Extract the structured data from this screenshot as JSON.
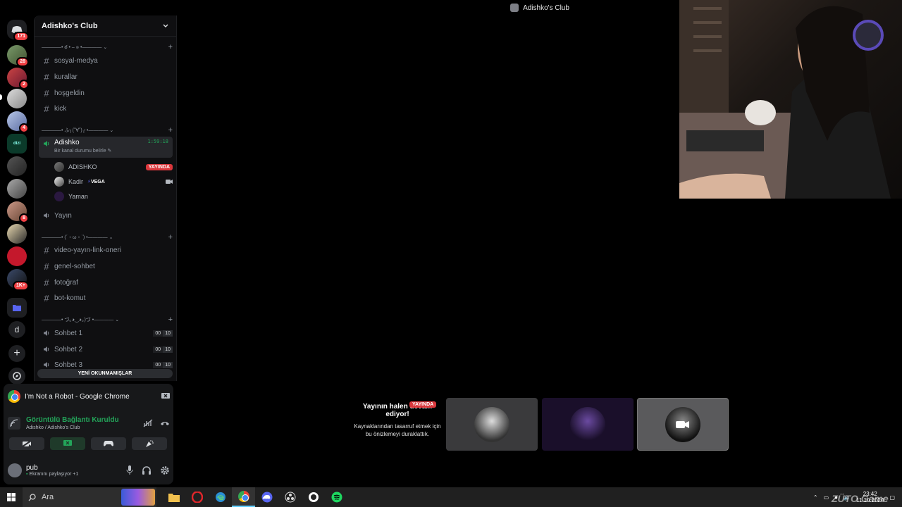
{
  "window": {
    "title": "Adishko's Club"
  },
  "rail": {
    "badges": [
      "171",
      "28",
      "2",
      "",
      "4",
      "",
      "",
      "",
      "8",
      "",
      "",
      "1K+"
    ],
    "dm_letter": "d"
  },
  "server": {
    "name": "Adishko's Club",
    "categories": [
      "————• ఠ • – ๏ •————",
      "————• ふ╮(˘∀˘)╭ •————",
      "————• (´・ω・`) •————",
      "————• づ｡◕‿◕｡)づ •————"
    ],
    "text_channels_1": [
      "sosyal-medya",
      "kurallar",
      "hoşgeldin",
      "kick"
    ],
    "active_voice": {
      "name": "Adishko",
      "timer": "1:59:18",
      "status": "Bir kanal durumu belirle"
    },
    "members": [
      {
        "name": "ADISHKO",
        "badge": "YAYINDA"
      },
      {
        "name": "Kadir",
        "tag": "VEGA"
      },
      {
        "name": "Yaman"
      }
    ],
    "voice_2": "Yayın",
    "text_channels_2": [
      "video-yayın-link-oneri",
      "genel-sohbet",
      "fotoğraf",
      "bot-komut"
    ],
    "voice_channels": [
      {
        "name": "Sohbet 1",
        "a": "00",
        "b": "10"
      },
      {
        "name": "Sohbet 2",
        "a": "00",
        "b": "10"
      },
      {
        "name": "Sohbet 3",
        "a": "00",
        "b": "10"
      }
    ],
    "unread_label": "YENİ OKUNMAMIŞLAR"
  },
  "panel": {
    "stream_title": "I'm Not a Robot - Google Chrome",
    "connection_status": "Görüntülü Bağlantı Kuruldu",
    "connection_sub": "Adishko / Adishko's Club",
    "user_name": "pub",
    "user_status": "Ekranını paylaşıyor +1"
  },
  "stream": {
    "tag": "YAYINDA",
    "title": "Yayının halen devam ediyor!",
    "desc": "Kaynaklarından tasarruf etmek için bu önizlemeyi duraklattık."
  },
  "taskbar": {
    "search_placeholder": "Ara",
    "time": "23:42",
    "date": "11.10.2024"
  },
  "watermark": "ZÜTO Game",
  "colors": {
    "accent": "#5865f2",
    "online": "#23a55a",
    "live": "#da373c"
  }
}
